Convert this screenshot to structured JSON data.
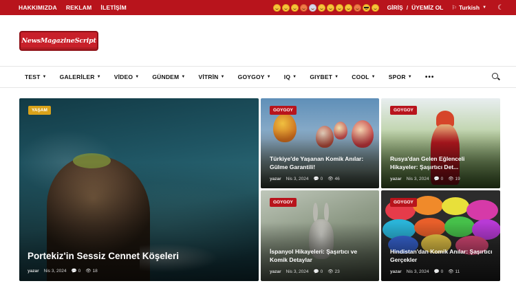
{
  "topbar": {
    "links": [
      "HAKKIMIZDA",
      "REKLAM",
      "İLETİŞİM"
    ],
    "login": "GİRİŞ",
    "separator": "/",
    "register": "ÜYEMİZ OL",
    "language": "Turkish",
    "reaction_icons": [
      "smile-icon",
      "surprised-icon",
      "sad-icon",
      "angry-icon",
      "rocket-icon",
      "laugh-icon",
      "wink-icon",
      "grin-icon",
      "lol-icon",
      "love-icon",
      "cool-icon",
      "scream-icon"
    ]
  },
  "logo": {
    "text": "NewsMagazineScript"
  },
  "nav": {
    "items": [
      "TEST",
      "GALERİLER",
      "VİDEO",
      "GÜNDEM",
      "VİTRİN",
      "GOYGOY",
      "IQ",
      "GIYBET",
      "COOL",
      "SPOR"
    ],
    "more": "•••"
  },
  "featured": {
    "category": "YAŞAM",
    "title": "Portekiz'in Sessiz Cennet Köşeleri",
    "author": "yazar",
    "date": "Nis 3, 2024",
    "comments": "0",
    "views": "18"
  },
  "cards": [
    {
      "category": "GOYGOY",
      "title": "Türkiye'de Yaşanan Komik Anılar: Gülme Garantili!",
      "author": "yazar",
      "date": "Nis 3, 2024",
      "comments": "0",
      "views": "46"
    },
    {
      "category": "GOYGOY",
      "title": "Rusya'dan Gelen Eğlenceli Hikayeler: Şaşırtıcı Det...",
      "author": "yazar",
      "date": "Nis 3, 2024",
      "comments": "0",
      "views": "19"
    },
    {
      "category": "GOYGOY",
      "title": "İspanyol Hikayeleri: Şaşırtıcı ve Komik Detaylar",
      "author": "yazar",
      "date": "Nis 3, 2024",
      "comments": "0",
      "views": "23"
    },
    {
      "category": "GOYGOY",
      "title": "Hindistan'dan Komik Anılar: Şaşırtıcı Gerçekler",
      "author": "yazar",
      "date": "Nis 3, 2024",
      "comments": "0",
      "views": "11"
    }
  ],
  "colors": {
    "brand": "#b8141c",
    "badge_featured": "#d9a21a"
  }
}
